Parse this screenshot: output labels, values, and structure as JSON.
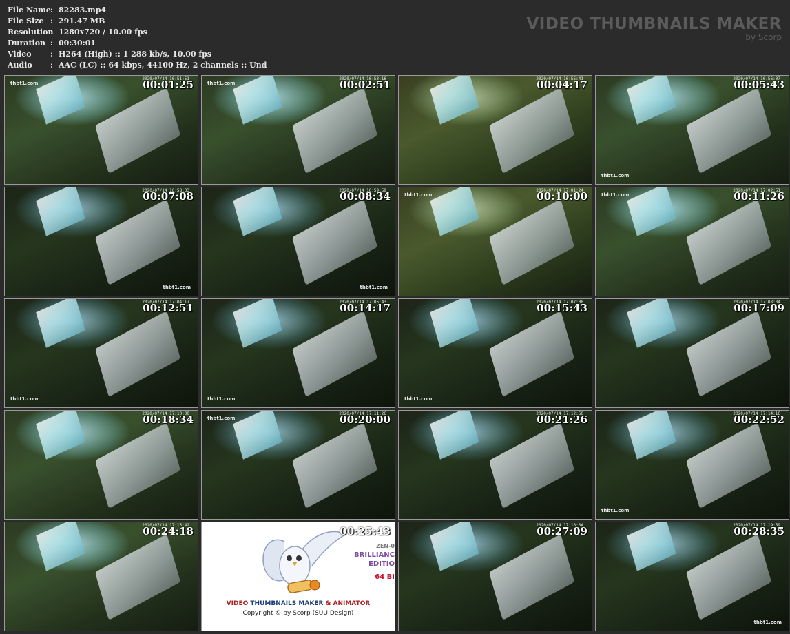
{
  "info": {
    "rows": [
      {
        "label": "File Name",
        "sep": ":",
        "value": "82283.mp4"
      },
      {
        "label": "File Size",
        "sep": ":",
        "value": "291.47 MB"
      },
      {
        "label": "Resolution",
        "sep": ":",
        "value": "1280x720 / 10.00 fps"
      },
      {
        "label": "Duration",
        "sep": ":",
        "value": "00:30:01"
      },
      {
        "label": "Video",
        "sep": ":",
        "value": "H264 (High) :: 1 288 kb/s, 10.00 fps"
      },
      {
        "label": "Audio",
        "sep": ":",
        "value": "AAC (LC) :: 64 kbps, 44100 Hz, 2 channels :: Und"
      }
    ]
  },
  "brand": {
    "title": "VIDEO THUMBNAILS MAKER",
    "subtitle": "by Scorp"
  },
  "thumbnails": [
    {
      "time": "00:01:25",
      "camdate": "2020/07/14 16:51:51",
      "wm": "thbt1.com",
      "wmpos": "tl",
      "tone": "normal"
    },
    {
      "time": "00:02:51",
      "camdate": "2020/07/14 16:53:16",
      "wm": "thbt1.com",
      "wmpos": "tl",
      "tone": "normal"
    },
    {
      "time": "00:04:17",
      "camdate": "2020/07/14 16:55:41",
      "wm": "",
      "wmpos": "",
      "tone": "warm"
    },
    {
      "time": "00:05:43",
      "camdate": "2020/07/14 16:56:07",
      "wm": "thbt1.com",
      "wmpos": "bl",
      "tone": "normal"
    },
    {
      "time": "00:07:08",
      "camdate": "2020/07/14 16:58:33",
      "wm": "thbt1.com",
      "wmpos": "br",
      "tone": "dark"
    },
    {
      "time": "00:08:34",
      "camdate": "2020/07/14 16:59:59",
      "wm": "thbt1.com",
      "wmpos": "br",
      "tone": "dark"
    },
    {
      "time": "00:10:00",
      "camdate": "2020/07/14 17:01:24",
      "wm": "thbt1.com",
      "wmpos": "tl",
      "tone": "warm"
    },
    {
      "time": "00:11:26",
      "camdate": "2020/07/14 17:02:51",
      "wm": "thbt1.com",
      "wmpos": "tl",
      "tone": "normal"
    },
    {
      "time": "00:12:51",
      "camdate": "2020/07/14 17:04:17",
      "wm": "thbt1.com",
      "wmpos": "bl",
      "tone": "dark"
    },
    {
      "time": "00:14:17",
      "camdate": "2020/07/14 17:05:43",
      "wm": "thbt1.com",
      "wmpos": "bl",
      "tone": "dark"
    },
    {
      "time": "00:15:43",
      "camdate": "2020/07/14 17:07:08",
      "wm": "thbt1.com",
      "wmpos": "bl",
      "tone": "dark"
    },
    {
      "time": "00:17:09",
      "camdate": "2020/07/14 17:08:34",
      "wm": "",
      "wmpos": "",
      "tone": "dark"
    },
    {
      "time": "00:18:34",
      "camdate": "2020/07/14 17:10:00",
      "wm": "",
      "wmpos": "",
      "tone": "normal"
    },
    {
      "time": "00:20:00",
      "camdate": "2020/07/14 17:11:26",
      "wm": "thbt1.com",
      "wmpos": "tl",
      "tone": "dark"
    },
    {
      "time": "00:21:26",
      "camdate": "2020/07/14 17:12:50",
      "wm": "",
      "wmpos": "",
      "tone": "dark"
    },
    {
      "time": "00:22:52",
      "camdate": "2020/07/14 17:14:16",
      "wm": "thbt1.com",
      "wmpos": "bl",
      "tone": "dark"
    },
    {
      "time": "00:24:18",
      "camdate": "2020/07/14 17:15:42",
      "wm": "",
      "wmpos": "",
      "tone": "normal"
    },
    {
      "time": "00:25:43",
      "promo": true
    },
    {
      "time": "00:27:09",
      "camdate": "2020/07/14 17:18:34",
      "wm": "",
      "wmpos": "",
      "tone": "dark"
    },
    {
      "time": "00:28:35",
      "camdate": "2020/07/14 17:19:59",
      "wm": "thbt1.com",
      "wmpos": "br",
      "tone": "dark"
    }
  ],
  "promo": {
    "edition_line1": "ZEN-0",
    "edition_line2": "BRILLIANC",
    "edition_line3": "EDITIO",
    "edition_line4": "64 BI",
    "title_red1": "VIDEO",
    "title_blue": " THUMBNAILS MAKER ",
    "title_red2": "& ANIMATOR",
    "copyright": "Copyright © by Scorp (SUU Design)"
  }
}
